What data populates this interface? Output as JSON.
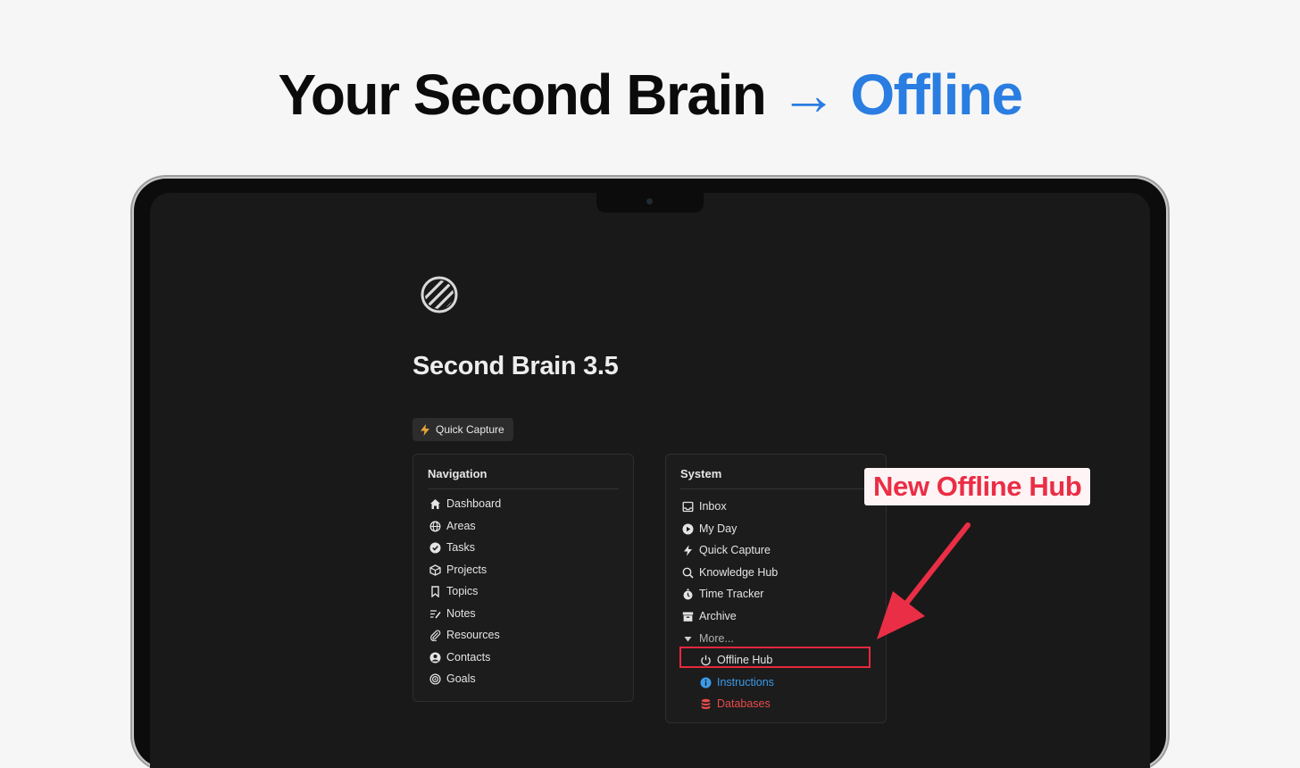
{
  "headline": {
    "main": "Your Second Brain",
    "arrow": "→",
    "accent": "Offline"
  },
  "page": {
    "title": "Second Brain 3.5",
    "quick_capture": "Quick Capture"
  },
  "navigation": {
    "title": "Navigation",
    "items": [
      {
        "label": "Dashboard",
        "icon": "home-icon"
      },
      {
        "label": "Areas",
        "icon": "globe-icon"
      },
      {
        "label": "Tasks",
        "icon": "check-circle-icon"
      },
      {
        "label": "Projects",
        "icon": "box-icon"
      },
      {
        "label": "Topics",
        "icon": "bookmark-icon"
      },
      {
        "label": "Notes",
        "icon": "notes-icon"
      },
      {
        "label": "Resources",
        "icon": "paperclip-icon"
      },
      {
        "label": "Contacts",
        "icon": "user-circle-icon"
      },
      {
        "label": "Goals",
        "icon": "target-icon"
      }
    ]
  },
  "system": {
    "title": "System",
    "items": [
      {
        "label": "Inbox",
        "icon": "inbox-icon"
      },
      {
        "label": "My Day",
        "icon": "play-circle-icon"
      },
      {
        "label": "Quick Capture",
        "icon": "bolt-icon"
      },
      {
        "label": "Knowledge Hub",
        "icon": "search-icon"
      },
      {
        "label": "Time Tracker",
        "icon": "stopwatch-icon"
      },
      {
        "label": "Archive",
        "icon": "archive-icon"
      }
    ],
    "more": "More...",
    "sub_items": [
      {
        "label": "Offline Hub",
        "icon": "power-icon"
      },
      {
        "label": "Instructions",
        "icon": "info-icon"
      },
      {
        "label": "Databases",
        "icon": "database-icon"
      }
    ]
  },
  "annotation": {
    "callout": "New Offline Hub"
  },
  "colors": {
    "accent_blue": "#2a7de1",
    "callout_red": "#ea2e45",
    "screen_bg": "#191919"
  }
}
